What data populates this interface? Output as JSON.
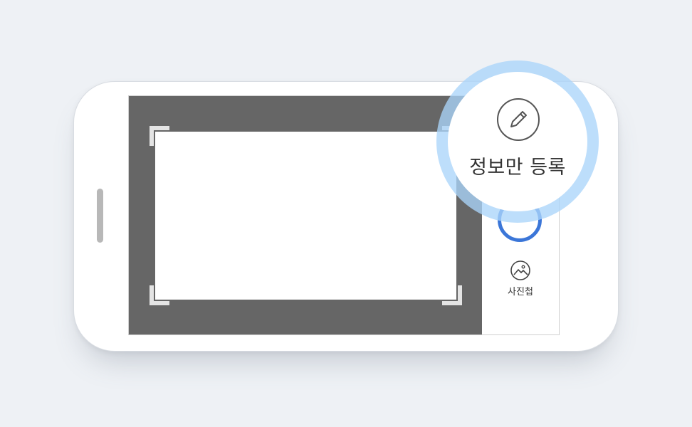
{
  "camera": {
    "gallery_label": "사진첩",
    "shutter_color": "#3b76d8"
  },
  "callout": {
    "label": "정보만 등록",
    "icon": "pencil-icon",
    "ring_color": "#aad5fa"
  },
  "icons": {
    "gallery": "image-icon",
    "edit": "pencil-icon"
  }
}
